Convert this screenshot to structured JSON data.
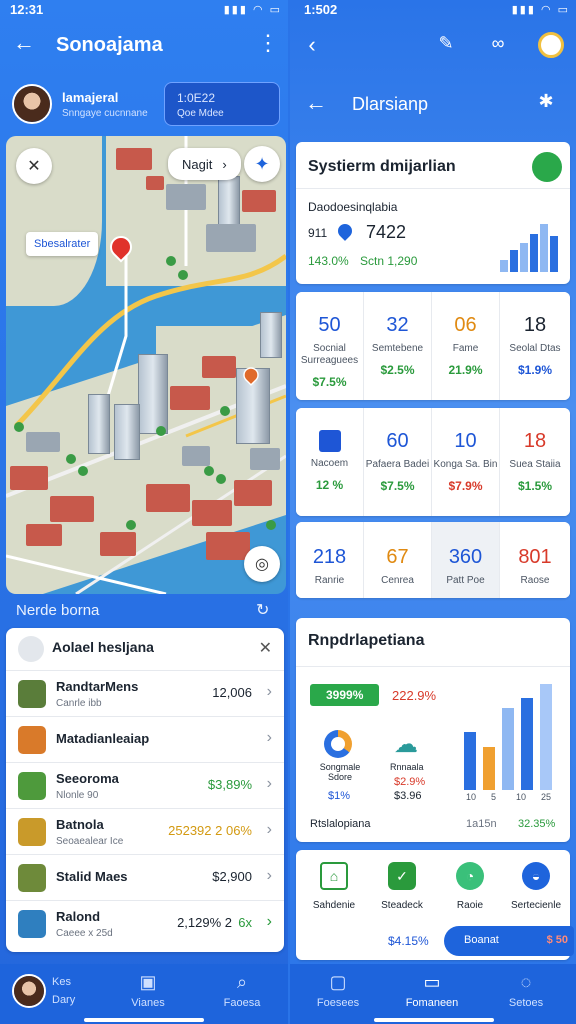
{
  "left": {
    "status": {
      "time": "12:31",
      "icons": "▮▮▮ ◠ ▭"
    },
    "appbar": {
      "title": "Sonoajama"
    },
    "user": {
      "name": "lamajeral",
      "subtitle": "Snngaye cucnnane",
      "badge_line1": "1:0E22",
      "badge_line2": "Qoe Mdee"
    },
    "map": {
      "chip_label": "Nagit",
      "chip_arrow": "›",
      "location_label": "Sbesalrater",
      "caption": "Nerde borna"
    },
    "list": {
      "header": "Aolael hesljana",
      "close": "✕",
      "items": [
        {
          "title": "RandtarMens",
          "sub": "Canrle ibb",
          "value": "12,006",
          "value_color": "#1b2430",
          "icon_color": "#5a7d3a"
        },
        {
          "title": "Matadianleaiap",
          "sub": "",
          "value": "",
          "value_color": "#1b2430",
          "icon_color": "#d97a2a"
        },
        {
          "title": "Seeoroma",
          "sub": "Nlonle 90",
          "value": "$3,89%",
          "value_color": "#2a9a3c",
          "icon_color": "#4e9a3c"
        },
        {
          "title": "Batnola",
          "sub": "Seoaealear Ice",
          "value": "252392 2 06%",
          "value_color": "#d39a12",
          "icon_color": "#c99a2a"
        },
        {
          "title": "Stalid Maes",
          "sub": "",
          "value": "$2,900",
          "value_color": "#1b2430",
          "icon_color": "#6e8a3a"
        },
        {
          "title": "Ralond",
          "sub": "Caeee x 25d",
          "value": "2,129% 2",
          "value_color": "#1b2430",
          "extra": "6x",
          "icon_color": "#2f7fbf"
        }
      ]
    },
    "nav": [
      {
        "label": "Dary",
        "top": "Kes",
        "icon": "avatar"
      },
      {
        "label": "Vianes",
        "icon": "▣"
      },
      {
        "label": "Faoesa",
        "icon": "⌕"
      }
    ]
  },
  "right": {
    "status": {
      "time": "1:502",
      "icons": "▮▮▮ ◠ ▭"
    },
    "sub_appbar": {
      "title": "Dlarsianp"
    },
    "summary": {
      "title": "Systierm dmijarlian",
      "subtitle": "Daodoesinqlabia",
      "num1": "911",
      "num2": "7422",
      "pct_left": "143.0%",
      "pct_right": "Sctn 1,290",
      "bars": [
        25,
        45,
        60,
        80,
        100,
        75
      ]
    },
    "tiles_row1": [
      {
        "num": "50",
        "label": "Socnial Surreaguees",
        "val": "$7.5%",
        "num_color": "#1e56d6",
        "val_color": "#2a9a3c"
      },
      {
        "num": "32",
        "label": "Semtebene",
        "val": "$2.5%",
        "num_color": "#1e56d6",
        "val_color": "#2a9a3c"
      },
      {
        "num": "06",
        "label": "Fame",
        "val": "21.9%",
        "num_color": "#e08a12",
        "val_color": "#2a9a3c"
      },
      {
        "num": "18",
        "label": "Seolal Dtas",
        "val": "$1.9%",
        "num_color": "#1b2430",
        "val_color": "#1e56d6"
      }
    ],
    "tiles_row2": [
      {
        "num": "",
        "label": "Nacoem",
        "val": "12 %",
        "num_color": "#1e56d6",
        "val_color": "#2a9a3c",
        "icon": "list"
      },
      {
        "num": "60",
        "label": "Pafaera Badei",
        "val": "$7.5%",
        "num_color": "#1e56d6",
        "val_color": "#2a9a3c"
      },
      {
        "num": "10",
        "label": "Konga Sa. Bin",
        "val": "$7.9%",
        "num_color": "#1e56d6",
        "val_color": "#d83a2a"
      },
      {
        "num": "18",
        "label": "Suea Staiia",
        "val": "$1.5%",
        "num_color": "#d83a2a",
        "val_color": "#2a9a3c"
      }
    ],
    "tiles_row3": [
      {
        "num": "218",
        "label": "Ranrie",
        "num_color": "#1e56d6"
      },
      {
        "num": "67",
        "label": "Cenrea",
        "num_color": "#e08a12"
      },
      {
        "num": "360",
        "label": "Patt Poe",
        "num_color": "#1e56d6"
      },
      {
        "num": "801",
        "label": "Raose",
        "num_color": "#d83a2a"
      }
    ],
    "report": {
      "title": "Rnpdrlapetiana",
      "badge": "3999%",
      "badge_pct": "222.9%",
      "item1_label": "Songmale Sdore",
      "item1_val": "$1%",
      "item2_label": "Rnnaala",
      "item2_val1": "$2.9%",
      "item2_val2": "$3.96",
      "footer_left": "Rtslalopiana",
      "footer_mid": "1a15n",
      "footer_right": "32.35%",
      "bar_labels": [
        "10",
        "5",
        "10",
        "25"
      ],
      "bars": [
        {
          "v": 60,
          "c": "#2a6fe0"
        },
        {
          "v": 45,
          "c": "#f0a030"
        },
        {
          "v": 85,
          "c": "#8fb8f2"
        },
        {
          "v": 95,
          "c": "#2a6fe0"
        },
        {
          "v": 110,
          "c": "#a8c8f8"
        }
      ]
    },
    "actions": [
      {
        "label": "Sahdenie",
        "color": "#2a9a3c"
      },
      {
        "label": "Steadeck",
        "color": "#2a9a3c"
      },
      {
        "label": "Raoie",
        "color": "#3ac07a"
      },
      {
        "label": "Sertecienle",
        "color": "#1e64dc"
      }
    ],
    "action_pct": "$4.15%",
    "cta": "Boanat",
    "cta_badge": "$ 50",
    "nav": [
      {
        "label": "Foesees",
        "icon": "▢"
      },
      {
        "label": "Fomaneen",
        "icon": "▭"
      },
      {
        "label": "Setoes",
        "icon": "◌"
      }
    ]
  }
}
